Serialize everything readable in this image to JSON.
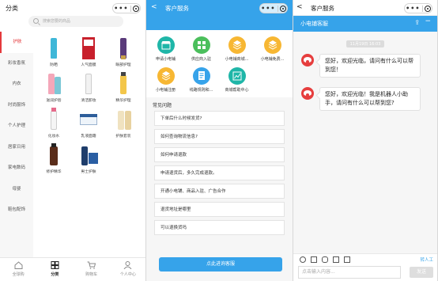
{
  "screen1": {
    "title": "分类",
    "search_placeholder": "搜索您要的商品",
    "nav": [
      "护肤",
      "彩妆香氛",
      "内衣",
      "时尚服饰",
      "个人护理",
      "居家日用",
      "家电数码",
      "母婴",
      "鞋包配饰"
    ],
    "active_nav": "护肤",
    "products": [
      {
        "name": "防晒",
        "icon": "sunscreen-tube"
      },
      {
        "name": "人气面膜",
        "icon": "mask-box"
      },
      {
        "name": "眼部护理",
        "icon": "eye-cream-tube"
      },
      {
        "name": "滋润护唇",
        "icon": "lip-balm"
      },
      {
        "name": "清洁卸妆",
        "icon": "cleanser-tube"
      },
      {
        "name": "精华护理",
        "icon": "essence-bottle"
      },
      {
        "name": "化妆水",
        "icon": "toner-bottle"
      },
      {
        "name": "乳液面霜",
        "icon": "cream-jar"
      },
      {
        "name": "护肤套装",
        "icon": "skincare-set"
      },
      {
        "name": "修护精华",
        "icon": "serum-bottle"
      },
      {
        "name": "男士护肤",
        "icon": "men-skincare"
      }
    ],
    "tabs": [
      {
        "label": "全球购",
        "icon": "home-icon"
      },
      {
        "label": "分类",
        "icon": "category-icon"
      },
      {
        "label": "购物车",
        "icon": "cart-icon"
      },
      {
        "label": "个人中心",
        "icon": "user-icon"
      }
    ],
    "active_tab": "分类"
  },
  "screen2": {
    "title": "客户服务",
    "back": "<",
    "services": [
      {
        "label": "申请小电铺",
        "color": "#1fb6a8",
        "icon": "store-icon"
      },
      {
        "label": "供应商入驻",
        "color": "#4bbf5c",
        "icon": "grid-icon"
      },
      {
        "label": "小电铺商城...",
        "color": "#f7b733",
        "icon": "cube-icon"
      },
      {
        "label": "小电铺免费...",
        "color": "#f7b733",
        "icon": "cube-icon"
      },
      {
        "label": "小电铺注册",
        "color": "#f7b733",
        "icon": "cube-icon"
      },
      {
        "label": "线路规则和...",
        "color": "#36a3ea",
        "icon": "document-icon"
      },
      {
        "label": "商城帮助中心",
        "color": "#1fb6a8",
        "icon": "chart-icon"
      }
    ],
    "faq_title": "常见问题",
    "faq": [
      "下单后什么时候发货?",
      "如何查询物流信息?",
      "如何申请退款",
      "申请退货后，多久完成退款。",
      "开通小电铺、商品入驻、广告合作",
      "退货地址是哪里",
      "可以退换货吗"
    ],
    "button": "点此进询客服"
  },
  "screen3": {
    "title": "客户服务",
    "back": "<",
    "bar_title": "小电铺客服",
    "time": "11月19日 16:03",
    "messages": [
      "您好，欢迎光临，请问有什么可以帮到您！",
      "您好，欢迎光临！我是机器人小助手，请问有什么可以帮到您?"
    ],
    "human": "转人工",
    "input_placeholder": "点击输入内容...",
    "send": "发送"
  }
}
